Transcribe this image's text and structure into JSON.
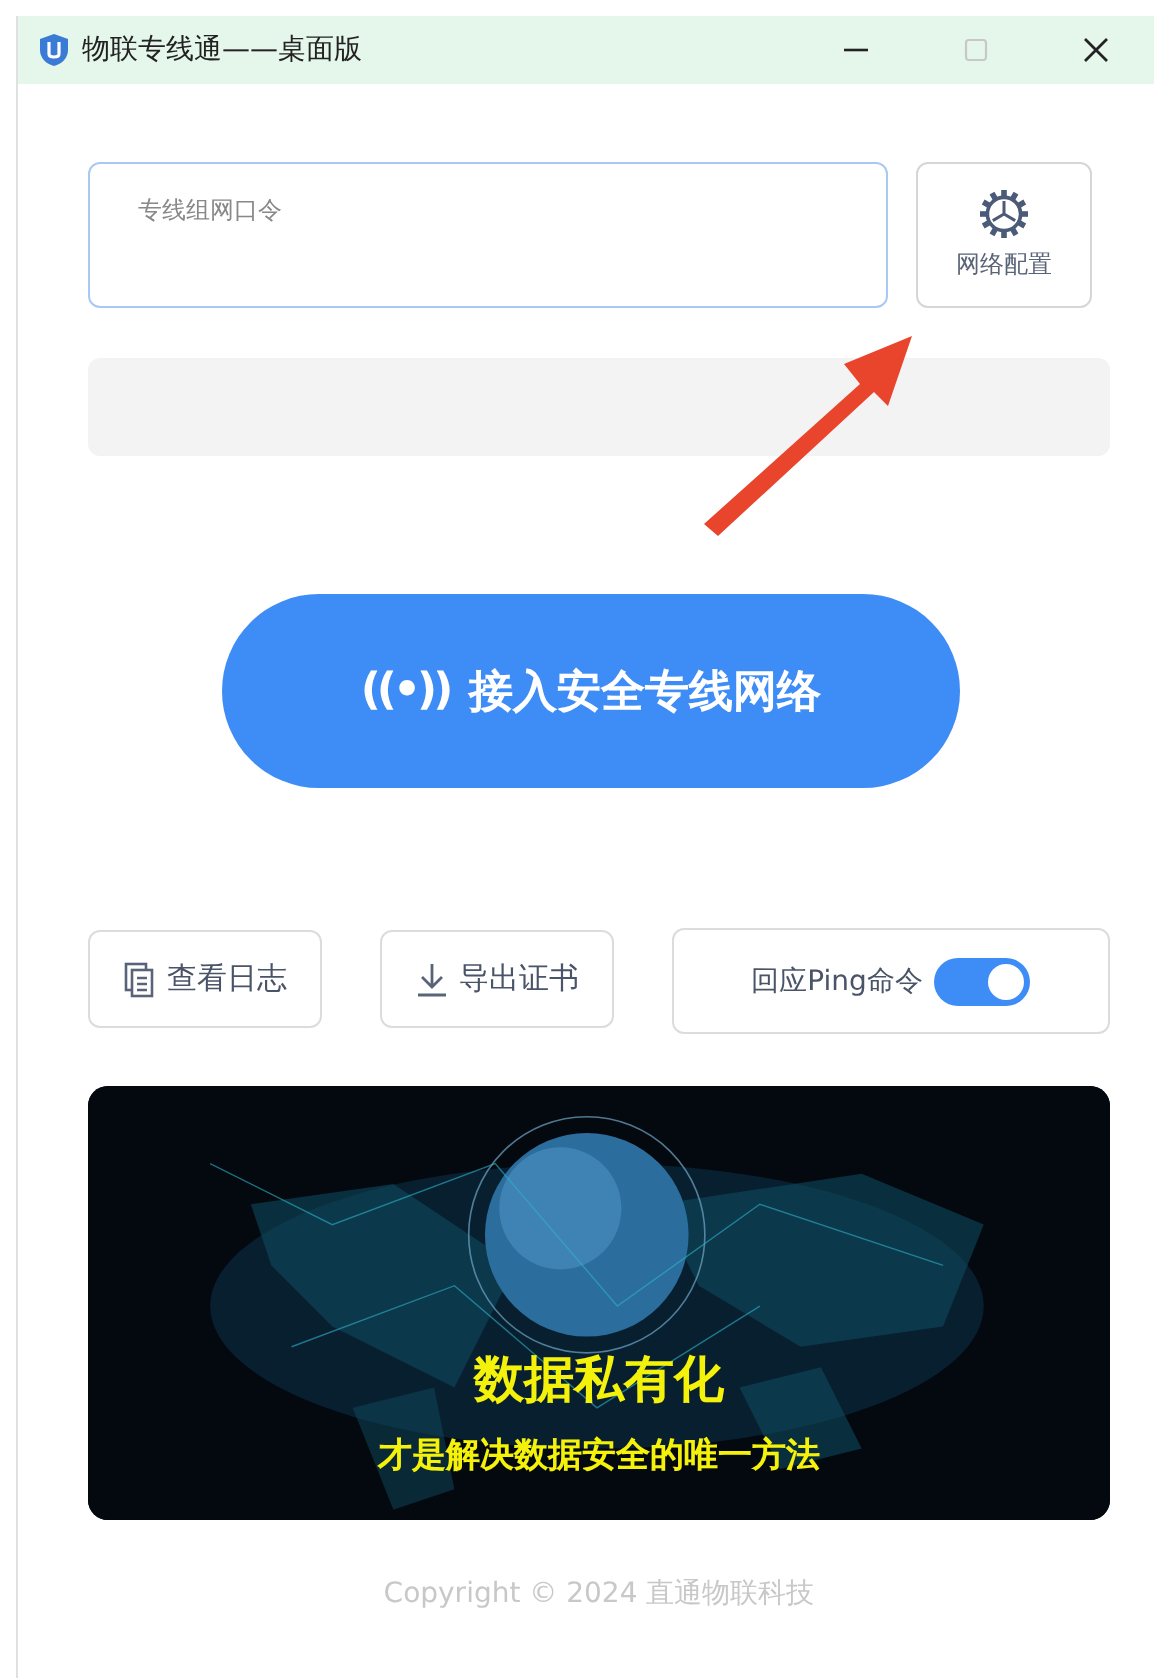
{
  "window": {
    "title": "物联专线通——桌面版"
  },
  "token_field": {
    "label": "专线组网口令"
  },
  "config_button": {
    "label": "网络配置"
  },
  "connect_button": {
    "icon": "((•))",
    "label": "接入安全专线网络"
  },
  "actions": [
    {
      "kind": "button",
      "label": "查看日志"
    },
    {
      "kind": "button",
      "label": "导出证书"
    },
    {
      "kind": "toggle",
      "label": "回应Ping命令",
      "on": true
    }
  ],
  "banner": {
    "kind": "picture",
    "headline": "数据私有化",
    "subline": "才是解决数据安全的唯一方法"
  },
  "footer": "Copyright © 2024 直通物联科技"
}
